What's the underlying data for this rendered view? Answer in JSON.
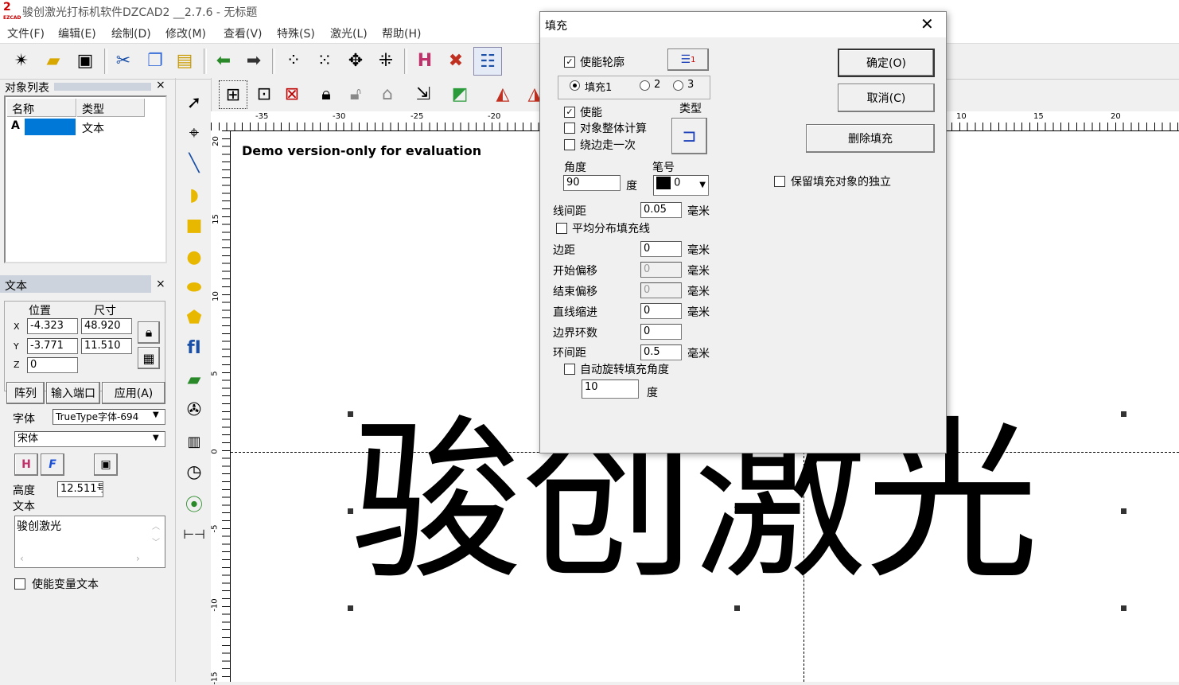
{
  "app": {
    "title": "骏创激光打标机软件DZCAD2 __2.7.6 - 无标题",
    "logo_text": "EZCAD"
  },
  "menu": [
    "文件(F)",
    "编辑(E)",
    "绘制(D)",
    "修改(M)",
    "查看(V)",
    "特殊(S)",
    "激光(L)",
    "帮助(H)"
  ],
  "object_list": {
    "title": "对象列表",
    "col_name": "名称",
    "col_type": "类型",
    "row_icon": "A",
    "row_type": "文本"
  },
  "text_panel": {
    "title": "文本",
    "pos_label": "位置",
    "size_label": "尺寸",
    "x_label": "X",
    "y_label": "Y",
    "z_label": "Z",
    "x": "-4.323",
    "y": "-3.771",
    "z": "0",
    "w": "48.920",
    "h": "11.510",
    "array_btn": "阵列",
    "input_port_btn": "输入端口",
    "apply_btn": "应用(A)",
    "font_label": "字体",
    "font_type": "TrueType字体-694",
    "font_name": "宋体",
    "height_label": "高度",
    "height": "12.511号",
    "text_label": "文本",
    "text_value": "骏创激光",
    "var_text": "使能变量文本"
  },
  "ruler": {
    "top": [
      "-35",
      "-30",
      "-25",
      "-20",
      "10",
      "15",
      "20"
    ],
    "left": [
      "20",
      "15",
      "10",
      "5",
      "0",
      "-5",
      "-10",
      "-15"
    ]
  },
  "canvas": {
    "watermark": "Demo version-only for evaluation",
    "text": "骏创激光"
  },
  "dialog": {
    "title": "填充",
    "enable_outline": "使能轮廓",
    "fill1": "填充1",
    "fill2": "2",
    "fill3": "3",
    "enable": "使能",
    "type_label": "类型",
    "whole_calc": "对象整体计算",
    "edge_once": "绕边走一次",
    "angle_label": "角度",
    "angle": "90",
    "angle_unit": "度",
    "pen_label": "笔号",
    "pen": "0",
    "line_spacing_label": "线间距",
    "line_spacing": "0.05",
    "mm": "毫米",
    "avg_dist": "平均分布填充线",
    "margin_label": "边距",
    "margin": "0",
    "start_offset_label": "开始偏移",
    "start_offset": "0",
    "end_offset_label": "结束偏移",
    "end_offset": "0",
    "line_shrink_label": "直线缩进",
    "line_shrink": "0",
    "loop_count_label": "边界环数",
    "loop_count": "0",
    "loop_spacing_label": "环间距",
    "loop_spacing": "0.5",
    "auto_rotate": "自动旋转填充角度",
    "rotate_angle": "10",
    "rotate_unit": "度",
    "ok": "确定(O)",
    "cancel": "取消(C)",
    "delete_fill": "删除填充",
    "keep_independent": "保留填充对象的独立"
  }
}
